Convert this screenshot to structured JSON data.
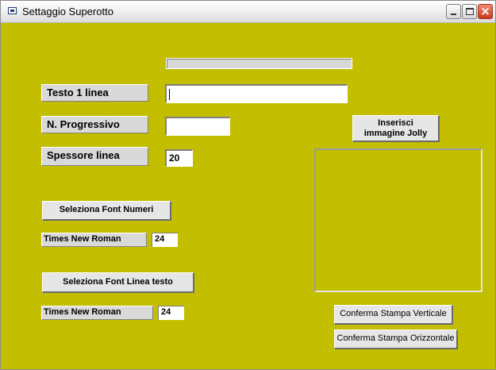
{
  "window": {
    "title": "Settaggio Superotto",
    "icon": "window-icon",
    "controls": [
      "minimize-icon",
      "maximize-icon",
      "close-icon"
    ],
    "background_color": "#c4be00"
  },
  "progress": {
    "value": 0
  },
  "fields": {
    "testo_label": "Testo 1 linea",
    "testo_value": "",
    "progressivo_label": "N. Progressivo",
    "progressivo_value": "",
    "spessore_label": "Spessore linea",
    "spessore_value": "20"
  },
  "font_numeri": {
    "button_label": "Seleziona Font Numeri",
    "font_name": "Times New Roman",
    "font_size": "24"
  },
  "font_testo": {
    "button_label": "Seleziona Font Linea testo",
    "font_name": "Times New Roman",
    "font_size": "24"
  },
  "image": {
    "button_line1": "Inserisci",
    "button_line2": "immagine Jolly"
  },
  "actions": {
    "print_vertical": "Conferma Stampa Verticale",
    "print_horizontal": "Conferma Stampa Orizzontale"
  }
}
